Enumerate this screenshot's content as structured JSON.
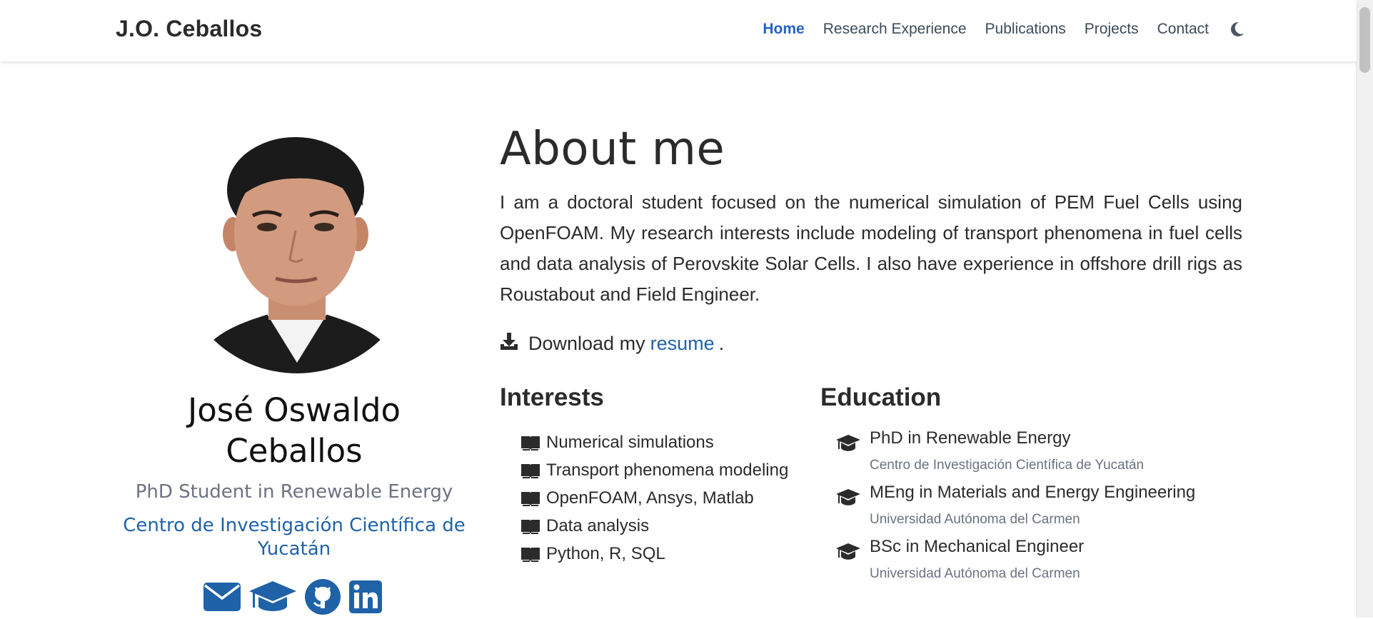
{
  "navbar": {
    "brand": "J.O. Ceballos",
    "items": [
      {
        "label": "Home",
        "active": true
      },
      {
        "label": "Research Experience"
      },
      {
        "label": "Publications"
      },
      {
        "label": "Projects"
      },
      {
        "label": "Contact"
      }
    ],
    "theme_icon": "moon-icon"
  },
  "profile": {
    "name": "José Oswaldo Ceballos",
    "role": "PhD Student in Renewable Energy",
    "organization": "Centro de Investigación Científica de Yucatán",
    "socials": [
      "envelope-icon",
      "graduation-cap-icon",
      "github-icon",
      "linkedin-icon"
    ]
  },
  "about": {
    "title": "About me",
    "bio": "I am a doctoral student focused on the numerical simulation of PEM Fuel Cells using OpenFOAM. My research interests include modeling of transport phenomena in fuel cells and data analysis of Perovskite Solar Cells. I also have experience in offshore drill rigs as Roustabout and Field Engineer.",
    "download_prefix": "Download my",
    "download_link": "resume",
    "download_suffix": "."
  },
  "interests": {
    "title": "Interests",
    "items": [
      "Numerical simulations",
      "Transport phenomena modeling",
      "OpenFOAM, Ansys, Matlab",
      "Data analysis",
      "Python, R, SQL"
    ]
  },
  "education": {
    "title": "Education",
    "items": [
      {
        "degree": "PhD in Renewable Energy",
        "institution": "Centro de Investigación Científica de Yucatán"
      },
      {
        "degree": "MEng in Materials and Energy Engineering",
        "institution": "Universidad Autónoma del Carmen"
      },
      {
        "degree": "BSc in Mechanical Engineer",
        "institution": "Universidad Autónoma del Carmen"
      }
    ]
  },
  "colors": {
    "accent": "#2563c6",
    "link": "#1f62a8",
    "text": "#2b2b2b",
    "muted": "#6b7280"
  }
}
